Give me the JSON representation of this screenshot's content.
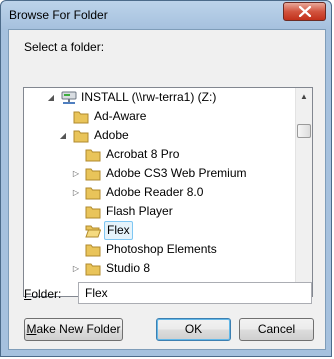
{
  "window": {
    "title": "Browse For Folder"
  },
  "prompt": "Select a folder:",
  "tree": [
    {
      "label": "INSTALL (\\\\rw-terra1) (Z:)",
      "icon": "network-drive-icon",
      "expander": "expanded"
    },
    {
      "label": "Ad-Aware",
      "icon": "folder-icon",
      "expander": "none"
    },
    {
      "label": "Adobe",
      "icon": "folder-icon",
      "expander": "expanded"
    },
    {
      "label": "Acrobat 8 Pro",
      "icon": "folder-icon",
      "expander": "none"
    },
    {
      "label": "Adobe CS3 Web Premium",
      "icon": "folder-icon",
      "expander": "collapsed"
    },
    {
      "label": "Adobe Reader 8.0",
      "icon": "folder-icon",
      "expander": "collapsed"
    },
    {
      "label": "Flash Player",
      "icon": "folder-icon",
      "expander": "none"
    },
    {
      "label": "Flex",
      "icon": "open-folder-icon",
      "expander": "none",
      "selected": true
    },
    {
      "label": "Photoshop Elements",
      "icon": "folder-icon",
      "expander": "none"
    },
    {
      "label": "Studio 8",
      "icon": "folder-icon",
      "expander": "collapsed"
    }
  ],
  "folder_field": {
    "label_accel": "F",
    "label_rest": "older:",
    "value": "Flex"
  },
  "buttons": {
    "make_new_folder_accel": "M",
    "make_new_folder_rest": "ake New Folder",
    "ok": "OK",
    "cancel": "Cancel"
  },
  "colors": {
    "selection_bg": "#e5f3fb",
    "selection_border": "#7fc7f3",
    "close_red": "#c2311b",
    "title_bg": "#a6c1de"
  }
}
